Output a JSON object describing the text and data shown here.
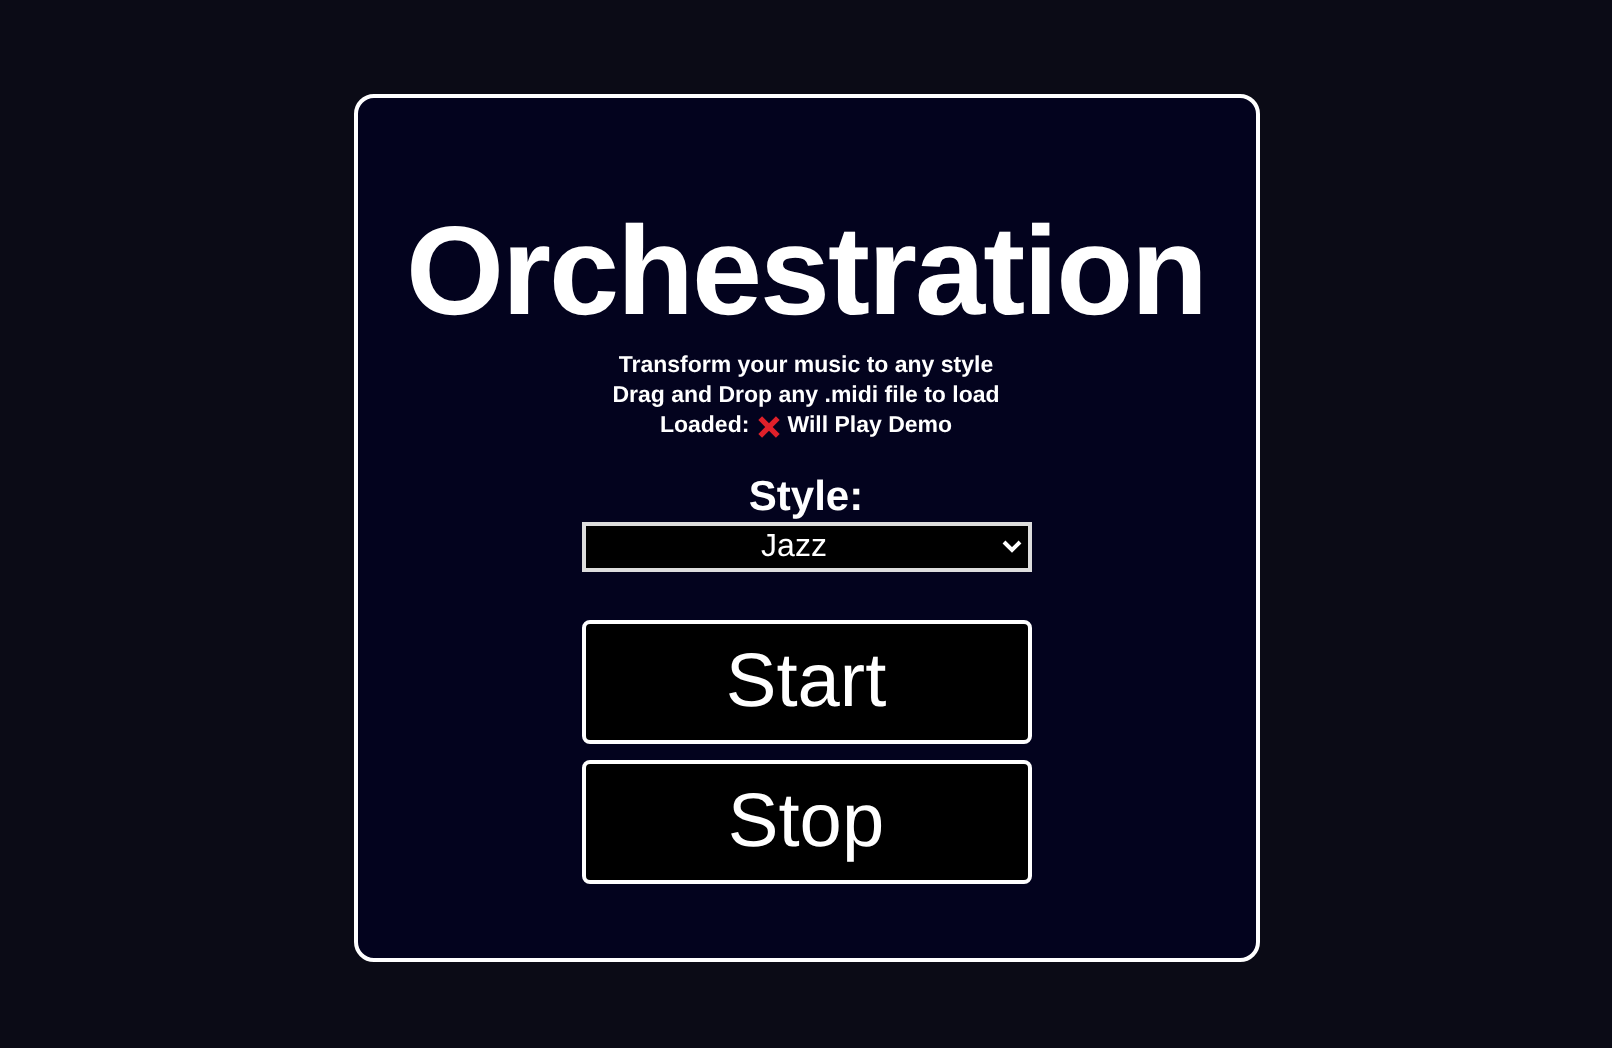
{
  "title": "Orchestration",
  "subtitle_lines": [
    "Transform your music to any style",
    "Drag and Drop any .midi file to load"
  ],
  "load_status": {
    "label": "Loaded:",
    "loaded": false,
    "text": "Will Play Demo"
  },
  "style": {
    "label": "Style:",
    "value": "Jazz"
  },
  "buttons": [
    "Start",
    "Stop"
  ]
}
